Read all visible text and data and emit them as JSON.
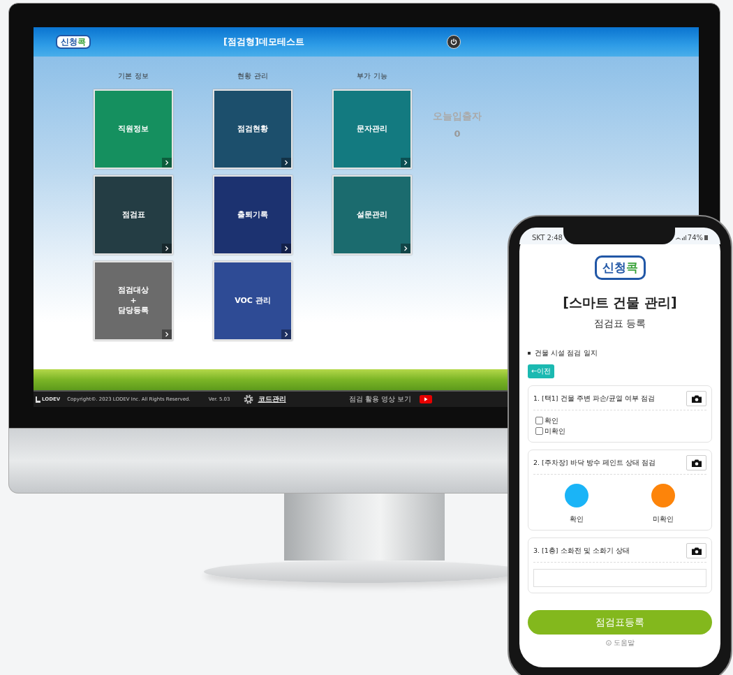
{
  "monitor": {
    "header": {
      "logo": "신청콕",
      "title": "[점검형]데모테스트"
    },
    "columns": [
      {
        "heading": "기본 정보",
        "tiles": [
          {
            "label": "직원정보",
            "color": "#15905f"
          },
          {
            "label": "점검표",
            "color": "#243d44"
          },
          {
            "label": "점검대상\n+\n담당등록",
            "color": "#6b6b6b"
          }
        ]
      },
      {
        "heading": "현황 관리",
        "tiles": [
          {
            "label": "점검현황",
            "color": "#1c4f6c"
          },
          {
            "label": "출퇴기록",
            "color": "#1c3270"
          },
          {
            "label": "VOC 관리",
            "color": "#2e4b95"
          }
        ]
      },
      {
        "heading": "부가 기능",
        "tiles": [
          {
            "label": "문자관리",
            "color": "#137a80"
          },
          {
            "label": "설문관리",
            "color": "#1b6b6e"
          }
        ]
      }
    ],
    "today": {
      "label": "오늘입출자",
      "count": "0"
    },
    "footer": {
      "brand": "LODEV",
      "copyright": "Copyright©. 2023 LODEV Inc. All Rights Reserved.",
      "version": "Ver. 5.03",
      "code_link": "코드관리",
      "video_link": "점검 활용 영상 보기"
    }
  },
  "phone": {
    "status_bar": {
      "carrier_time": "SKT 2:48",
      "battery": "74%"
    },
    "logo": "신청콕",
    "title": "[스마트 건물 관리]",
    "subtitle": "점검표 등록",
    "section": "건물 시설 점검 일지",
    "back_button": "←이전",
    "cards": [
      {
        "kind": "checkbox",
        "title": "1. [택1] 건물 주변 파손/균열 여부 점검",
        "options": [
          {
            "label": "확인",
            "checked": false
          },
          {
            "label": "미확인",
            "checked": false
          }
        ]
      },
      {
        "kind": "color",
        "title": "2. [주차장] 바닥 방수 페인트 상태 점검",
        "options": [
          {
            "label": "확인",
            "color": "#1ab4f7"
          },
          {
            "label": "미확인",
            "color": "#fd840a"
          }
        ]
      },
      {
        "kind": "text",
        "title": "3. [1층] 소화전 및 소화기 상태"
      }
    ],
    "submit": "점검표등록",
    "help": "도움말"
  }
}
